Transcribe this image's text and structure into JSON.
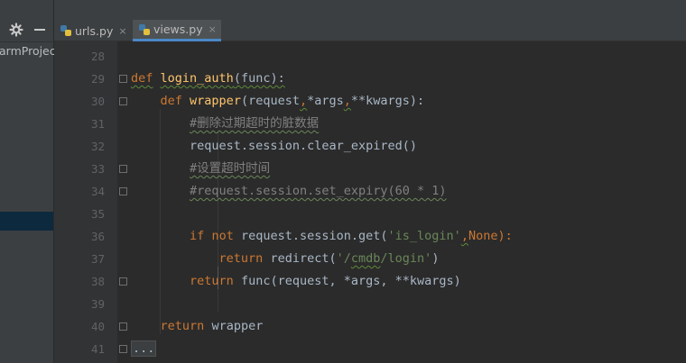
{
  "project_panel": {
    "label": "armProject",
    "settings_icon": "gear-icon",
    "collapse_icon": "minus-icon"
  },
  "tabs": [
    {
      "name": "urls.py",
      "close": "×",
      "active": false
    },
    {
      "name": "views.py",
      "close": "×",
      "active": true
    }
  ],
  "editor": {
    "line_numbers": [
      "28",
      "29",
      "30",
      "31",
      "32",
      "33",
      "34",
      "35",
      "36",
      "37",
      "38",
      "39",
      "40",
      "41"
    ],
    "lines": {
      "l29": {
        "kw": "def",
        "fn": "login_auth",
        "rest": "(func):"
      },
      "l30": {
        "kw": "def",
        "fn": "wrapper",
        "a": "(request",
        "b": ",",
        "c": "*args",
        "d": ",",
        "e": "**kwargs):"
      },
      "l31": {
        "comment": "#删除过期超时的脏数据"
      },
      "l32": {
        "text": "request.session.clear_expired()"
      },
      "l33": {
        "comment": "#设置超时时间"
      },
      "l34": {
        "comment": "#request.session.set_expiry(60 * 1)"
      },
      "l36": {
        "kw1": "if",
        "kw2": "not",
        "a": "request.session.get(",
        "str": "'is_login'",
        "b": ",",
        "c": "None):"
      },
      "l37": {
        "kw": "return",
        "a": "redirect(",
        "s1": "'/",
        "s2": "cmdb",
        "s3": "/login'",
        "b": ")"
      },
      "l38": {
        "kw": "return",
        "text": "func(request, *args, **kwargs)"
      },
      "l40": {
        "kw": "return",
        "text": "wrapper"
      },
      "l41": {
        "folded": "..."
      }
    }
  },
  "colors": {
    "background": "#2b2b2b",
    "keyword": "#cc7832",
    "function": "#ffc66d",
    "comment": "#808080",
    "string": "#6a8759",
    "active_tab_underline": "#4a88c7"
  }
}
